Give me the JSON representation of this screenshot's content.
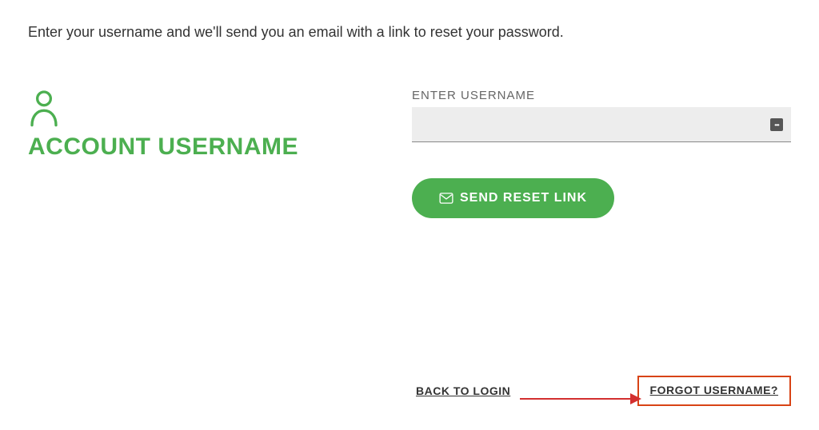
{
  "instruction": "Enter your username and we'll send you an email with a link to reset your password.",
  "section": {
    "title": "ACCOUNT USERNAME",
    "icon": "person-icon"
  },
  "form": {
    "username_label": "ENTER USERNAME",
    "username_value": "",
    "submit_label": "SEND RESET LINK"
  },
  "links": {
    "back_to_login": "BACK TO LOGIN",
    "forgot_username": "FORGOT USERNAME?"
  },
  "colors": {
    "accent": "#4caf50",
    "annotation": "#d32f2f"
  }
}
